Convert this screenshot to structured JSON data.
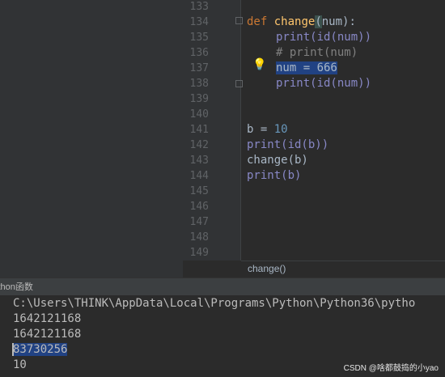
{
  "editor": {
    "line_numbers": [
      "133",
      "134",
      "135",
      "136",
      "137",
      "138",
      "139",
      "140",
      "141",
      "142",
      "143",
      "144",
      "145",
      "146",
      "147",
      "148",
      "149"
    ],
    "code": {
      "def_kw": "def",
      "func_name": "change",
      "param": "num",
      "def_tail": "):",
      "l135": "print(id(num))",
      "l136": "# print(num)",
      "l137": "num = 666",
      "l138": "print(id(num))",
      "l141_var": "b = ",
      "l141_num": "10",
      "l142": "print(id(b))",
      "l143": "change(b)",
      "l144": "print(b)"
    }
  },
  "breadcrumb": {
    "label": "change()"
  },
  "run_panel": {
    "tab_label": "ython函数"
  },
  "console": {
    "lines": [
      "C:\\Users\\THINK\\AppData\\Local\\Programs\\Python\\Python36\\pytho",
      "1642121168",
      "1642121168",
      "83730256",
      "10"
    ]
  },
  "watermark": {
    "text": "CSDN @啥都鼓捣的小yao"
  },
  "colors": {
    "keyword": "#cc7832",
    "function": "#ffc66d",
    "builtin": "#8888c6",
    "number": "#6897bb",
    "comment": "#808080",
    "selection": "#214283"
  }
}
